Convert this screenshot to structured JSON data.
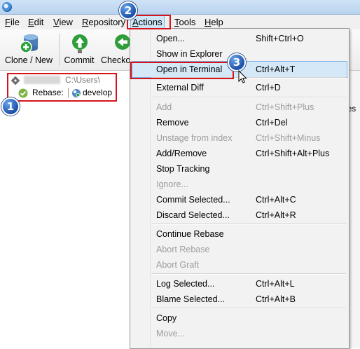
{
  "menubar": {
    "file": "File",
    "edit": "Edit",
    "view": "View",
    "repository": "Repository",
    "actions": "Actions",
    "tools": "Tools",
    "help": "Help"
  },
  "toolbar": {
    "clone_new": "Clone / New",
    "commit": "Commit",
    "checkout": "Checko"
  },
  "repo": {
    "path": "C:\\Users\\",
    "rebase_label": "Rebase:",
    "branch": "develop"
  },
  "right_pane": {
    "partial_text": "es"
  },
  "callouts": {
    "one": "1",
    "two": "2",
    "three": "3"
  },
  "actions_menu": [
    {
      "label": "Open...",
      "shortcut": "Shift+Ctrl+O",
      "enabled": true
    },
    {
      "label": "Show in Explorer",
      "shortcut": "",
      "enabled": true
    },
    {
      "label": "Open in Terminal",
      "shortcut": "Ctrl+Alt+T",
      "enabled": true,
      "highlighted": true
    },
    {
      "label": "External Diff",
      "shortcut": "Ctrl+D",
      "enabled": true
    },
    {
      "label": "Add",
      "shortcut": "Ctrl+Shift+Plus",
      "enabled": false
    },
    {
      "label": "Remove",
      "shortcut": "Ctrl+Del",
      "enabled": true
    },
    {
      "label": "Unstage from index",
      "shortcut": "Ctrl+Shift+Minus",
      "enabled": false
    },
    {
      "label": "Add/Remove",
      "shortcut": "Ctrl+Shift+Alt+Plus",
      "enabled": true
    },
    {
      "label": "Stop Tracking",
      "shortcut": "",
      "enabled": true
    },
    {
      "label": "Ignore...",
      "shortcut": "",
      "enabled": false
    },
    {
      "label": "Commit Selected...",
      "shortcut": "Ctrl+Alt+C",
      "enabled": true
    },
    {
      "label": "Discard Selected...",
      "shortcut": "Ctrl+Alt+R",
      "enabled": true
    },
    {
      "label": "Continue Rebase",
      "shortcut": "",
      "enabled": true
    },
    {
      "label": "Abort Rebase",
      "shortcut": "",
      "enabled": false
    },
    {
      "label": "Abort Graft",
      "shortcut": "",
      "enabled": false
    },
    {
      "label": "Log Selected...",
      "shortcut": "Ctrl+Alt+L",
      "enabled": true
    },
    {
      "label": "Blame Selected...",
      "shortcut": "Ctrl+Alt+B",
      "enabled": true
    },
    {
      "label": "Copy",
      "shortcut": "",
      "enabled": true
    },
    {
      "label": "Move...",
      "shortcut": "",
      "enabled": false
    }
  ],
  "colors": {
    "callout_red": "#d6141c",
    "badge_blue": "#1a4fa8",
    "highlight": "#d5e8f8"
  }
}
